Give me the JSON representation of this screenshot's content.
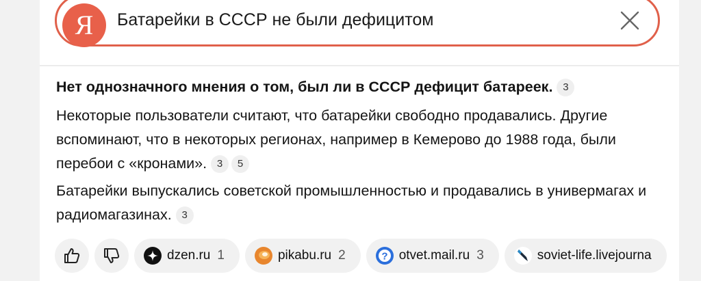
{
  "search": {
    "logo_letter": "Я",
    "query": "Батарейки в СССР не были дефицитом"
  },
  "answer": {
    "headline": "Нет однозначного мнения о том, был ли в СССР дефицит батареек",
    "headline_end": ".",
    "headline_refs": [
      "3"
    ],
    "paragraph2": "Некоторые пользователи считают, что батарейки свободно продавались. Другие вспоминают, что в некоторых регионах, например в Кемерово до 1988 года, были перебои с «кронами».",
    "paragraph2_refs": [
      "3",
      "5"
    ],
    "paragraph3": "Батарейки выпускались советской промышленностью и продавались в универмагах и радиомагазинах.",
    "paragraph3_refs": [
      "3"
    ]
  },
  "sources": [
    {
      "name": "dzen.ru",
      "count": "1",
      "icon": "dzen-icon",
      "color": "#111111"
    },
    {
      "name": "pikabu.ru",
      "count": "2",
      "icon": "pikabu-icon",
      "color": "#e8862e"
    },
    {
      "name": "otvet.mail.ru",
      "count": "3",
      "icon": "otvet-icon",
      "color": "#2b6fdc"
    },
    {
      "name": "soviet-life.livejourna",
      "count": "",
      "icon": "livejournal-icon",
      "color": "#2a8bc9"
    }
  ],
  "feedback": {
    "like_icon": "thumbs-up-icon",
    "dislike_icon": "thumbs-down-icon"
  },
  "colors": {
    "accent": "#e0604a",
    "pill_bg": "#f1f1f1"
  }
}
